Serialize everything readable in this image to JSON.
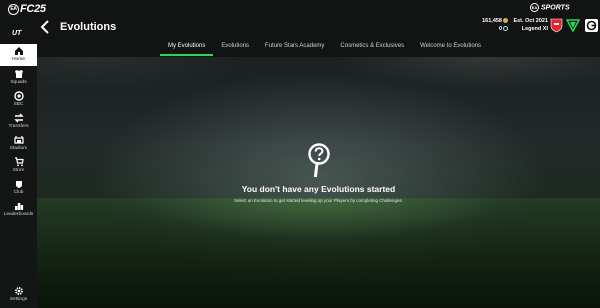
{
  "brand": {
    "ea": "EA",
    "logo": "FC25",
    "ut": "UT"
  },
  "header": {
    "back_icon": "chevron-left-icon",
    "title": "Evolutions",
    "ea_sports": "SPORTS",
    "ea_mark": "EA"
  },
  "tabs": [
    {
      "label": "My Evolutions",
      "active": true
    },
    {
      "label": "Evolutions",
      "active": false
    },
    {
      "label": "Future Stars Academy",
      "active": false
    },
    {
      "label": "Cosmetics & Exclusives",
      "active": false
    },
    {
      "label": "Welcome to Evolutions",
      "active": false
    }
  ],
  "wallet": {
    "coins": "161,458",
    "points": "0"
  },
  "club": {
    "established": "Est. Oct 2021",
    "name": "Legend XI"
  },
  "sidebar": [
    {
      "label": "Home",
      "icon": "home-icon",
      "active": true
    },
    {
      "label": "Squads",
      "icon": "squads-icon",
      "active": false
    },
    {
      "label": "SBC",
      "icon": "sbc-icon",
      "active": false
    },
    {
      "label": "Transfers",
      "icon": "transfers-icon",
      "active": false
    },
    {
      "label": "Stadium",
      "icon": "stadium-icon",
      "active": false
    },
    {
      "label": "Store",
      "icon": "store-icon",
      "active": false
    },
    {
      "label": "Club",
      "icon": "club-icon",
      "active": false
    },
    {
      "label": "Leaderboards",
      "icon": "leaderboards-icon",
      "active": false
    },
    {
      "label": "Settings",
      "icon": "gear-icon",
      "active": false
    }
  ],
  "empty_state": {
    "icon": "magnifier-question-icon",
    "title": "You don't have any Evolutions started",
    "subtitle": "Select an Evolution to get started leveling up your Players by completing Challenges."
  },
  "colors": {
    "accent": "#2bd35f",
    "coins": "#d4b24c",
    "crest": "#e8232a",
    "kit": "#2bd35f"
  }
}
